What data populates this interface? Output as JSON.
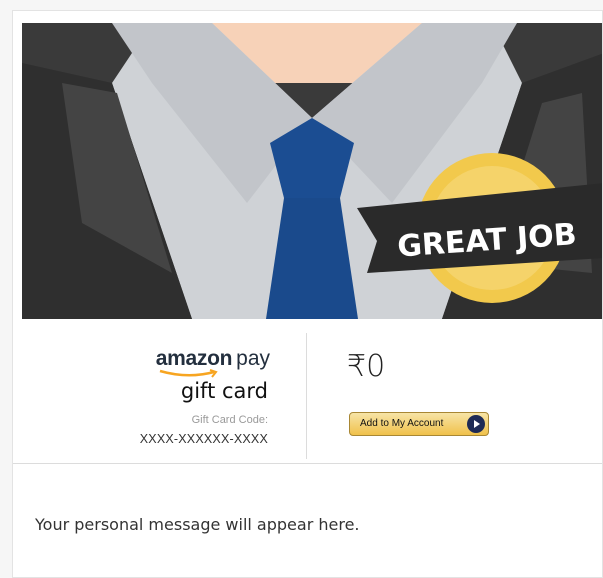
{
  "hero": {
    "badge_text": "GREAT JOB",
    "colors": {
      "jacket": "#3a3a3a",
      "shirt": "#c9ccd0",
      "tie": "#1b4d92",
      "skin": "#f7d2b8",
      "badge_gold": "#f2c94c",
      "ribbon": "#2a2a2a"
    }
  },
  "brand": {
    "logo_word": "amazon",
    "logo_suffix": "pay",
    "product": "gift card",
    "code_label": "Gift Card Code:",
    "code_value": "XXXX-XXXXXX-XXXX"
  },
  "amount": "₹0",
  "add_button_label": "Add to My Account",
  "message": "Your personal message will appear here."
}
